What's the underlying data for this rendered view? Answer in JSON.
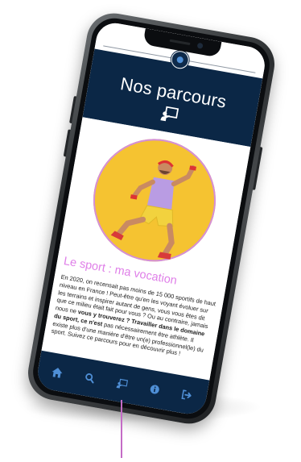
{
  "header": {
    "title": "Nos parcours"
  },
  "article": {
    "heading": "Le sport : ma vocation",
    "paragraph_parts": [
      "En 2020, on recensait pas moins de 15 000 sportifs de haut niveau en France ! Peut-être qu'en les voyant évoluer sur les terrains et inspirer autant de gens, vous vous êtes dit que ce milieu était fait pour vous ? Ou au contraire, jamais nous ne ",
      "vous y trouverez ? Travailler dans le domaine du sport, ce n'est",
      " pas nécessairement être athlète. Il existe plus d'une manière d'être un(e) professionnel(le) du sport. Suivez ce parcours pour en découvrir plus !"
    ],
    "footnote": "parcours pour en découvrir plus !"
  },
  "nav": {
    "items": [
      "home-icon",
      "search-icon",
      "board-icon",
      "info-icon",
      "logout-icon"
    ]
  },
  "colors": {
    "navy": "#0b2746",
    "heading_pink": "#df7fe8",
    "hero_yellow": "#f5c331"
  }
}
